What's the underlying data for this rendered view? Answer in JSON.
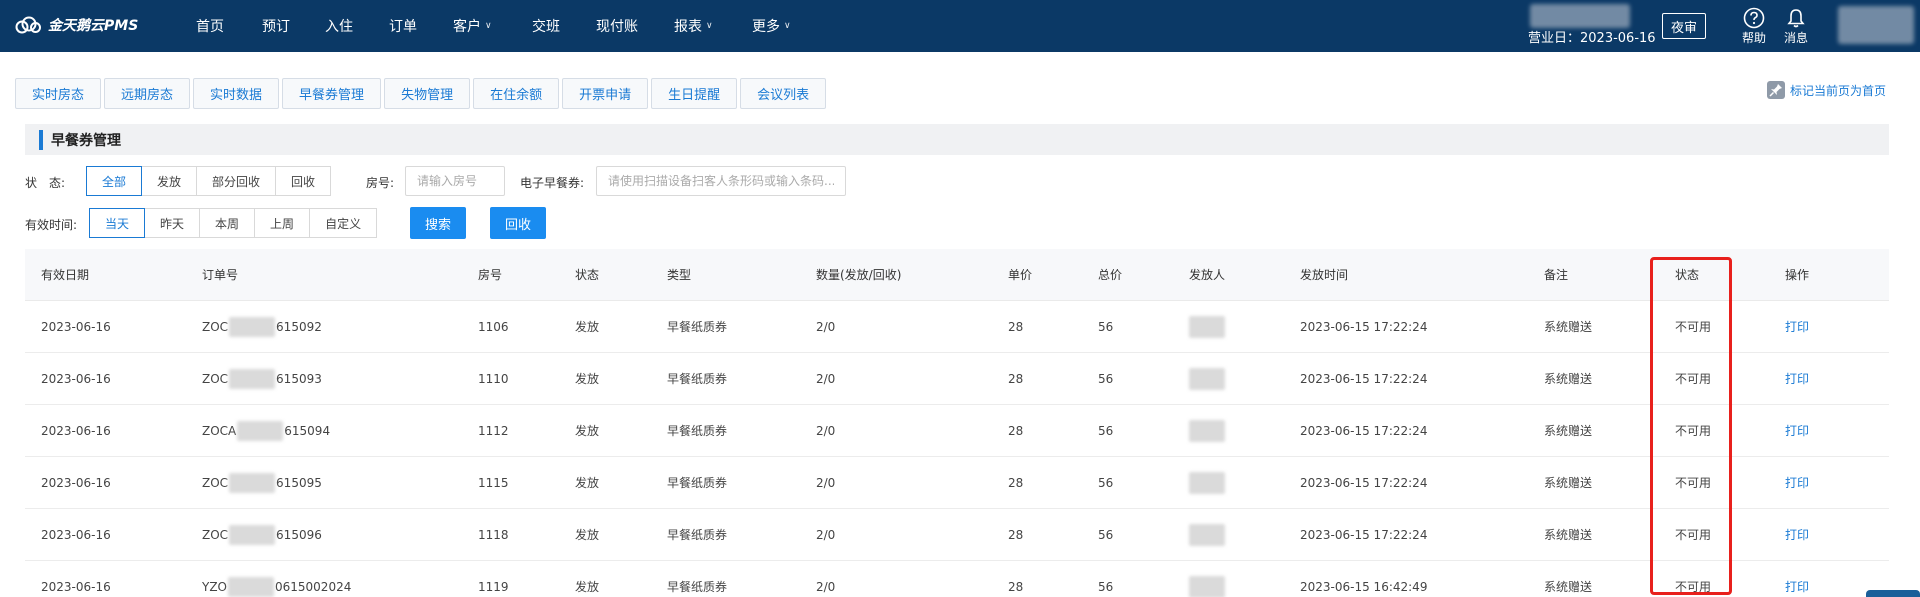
{
  "app": {
    "logo_text": "金天鹅云PMS"
  },
  "nav": [
    {
      "label": "首页",
      "dropdown": false
    },
    {
      "label": "预订",
      "dropdown": false
    },
    {
      "label": "入住",
      "dropdown": false
    },
    {
      "label": "订单",
      "dropdown": false
    },
    {
      "label": "客户",
      "dropdown": true
    },
    {
      "label": "交班",
      "dropdown": false
    },
    {
      "label": "现付账",
      "dropdown": false
    },
    {
      "label": "报表",
      "dropdown": true
    },
    {
      "label": "更多",
      "dropdown": true
    }
  ],
  "header": {
    "business_date": "营业日：2023-06-16",
    "night_audit_label": "夜审",
    "help_label": "帮助",
    "messages_label": "消息"
  },
  "subtabs": [
    "实时房态",
    "远期房态",
    "实时数据",
    "早餐券管理",
    "失物管理",
    "在住余额",
    "开票申请",
    "生日提醒",
    "会议列表"
  ],
  "mark_home_label": "标记当前页为首页",
  "section_title": "早餐券管理",
  "filters": {
    "status_label": "状　态:",
    "status_options": [
      "全部",
      "发放",
      "部分回收",
      "回收"
    ],
    "status_selected": "全部",
    "room_label": "房号:",
    "room_placeholder": "请输入房号",
    "voucher_label": "电子早餐券:",
    "voucher_placeholder": "请使用扫描设备扫客人条形码或输入条码...",
    "valid_time_label": "有效时间:",
    "time_options": [
      "当天",
      "昨天",
      "本周",
      "上周",
      "自定义"
    ],
    "time_selected": "当天",
    "search_label": "搜索",
    "recycle_label": "回收"
  },
  "table": {
    "columns": [
      "有效日期",
      "订单号",
      "房号",
      "状态",
      "类型",
      "数量(发放/回收)",
      "单价",
      "总价",
      "发放人",
      "发放时间",
      "备注",
      "状态",
      "操作"
    ],
    "rows": [
      {
        "date": "2023-06-16",
        "order_prefix": "ZOC",
        "order_suffix": "615092",
        "room": "1106",
        "status": "发放",
        "type": "早餐纸质券",
        "qty": "2/0",
        "price": "28",
        "total": "56",
        "issue_time": "2023-06-15 17:22:24",
        "remark": "系统赠送",
        "state": "不可用",
        "action": "打印"
      },
      {
        "date": "2023-06-16",
        "order_prefix": "ZOC",
        "order_suffix": "615093",
        "room": "1110",
        "status": "发放",
        "type": "早餐纸质券",
        "qty": "2/0",
        "price": "28",
        "total": "56",
        "issue_time": "2023-06-15 17:22:24",
        "remark": "系统赠送",
        "state": "不可用",
        "action": "打印"
      },
      {
        "date": "2023-06-16",
        "order_prefix": "ZOCA",
        "order_suffix": "615094",
        "room": "1112",
        "status": "发放",
        "type": "早餐纸质券",
        "qty": "2/0",
        "price": "28",
        "total": "56",
        "issue_time": "2023-06-15 17:22:24",
        "remark": "系统赠送",
        "state": "不可用",
        "action": "打印"
      },
      {
        "date": "2023-06-16",
        "order_prefix": "ZOC",
        "order_suffix": "615095",
        "room": "1115",
        "status": "发放",
        "type": "早餐纸质券",
        "qty": "2/0",
        "price": "28",
        "total": "56",
        "issue_time": "2023-06-15 17:22:24",
        "remark": "系统赠送",
        "state": "不可用",
        "action": "打印"
      },
      {
        "date": "2023-06-16",
        "order_prefix": "ZOC",
        "order_suffix": "615096",
        "room": "1118",
        "status": "发放",
        "type": "早餐纸质券",
        "qty": "2/0",
        "price": "28",
        "total": "56",
        "issue_time": "2023-06-15 17:22:24",
        "remark": "系统赠送",
        "state": "不可用",
        "action": "打印"
      },
      {
        "date": "2023-06-16",
        "order_prefix": "YZO",
        "order_suffix": "0615002024",
        "room": "1119",
        "status": "发放",
        "type": "早餐纸质券",
        "qty": "2/0",
        "price": "28",
        "total": "56",
        "issue_time": "2023-06-15 16:42:49",
        "remark": "系统赠送",
        "state": "不可用",
        "action": "打印"
      }
    ]
  },
  "colors": {
    "navbar": "#0b3966",
    "accent": "#1a7ad4",
    "primary_button": "#1a8cf0",
    "highlight": "#e8201c"
  }
}
